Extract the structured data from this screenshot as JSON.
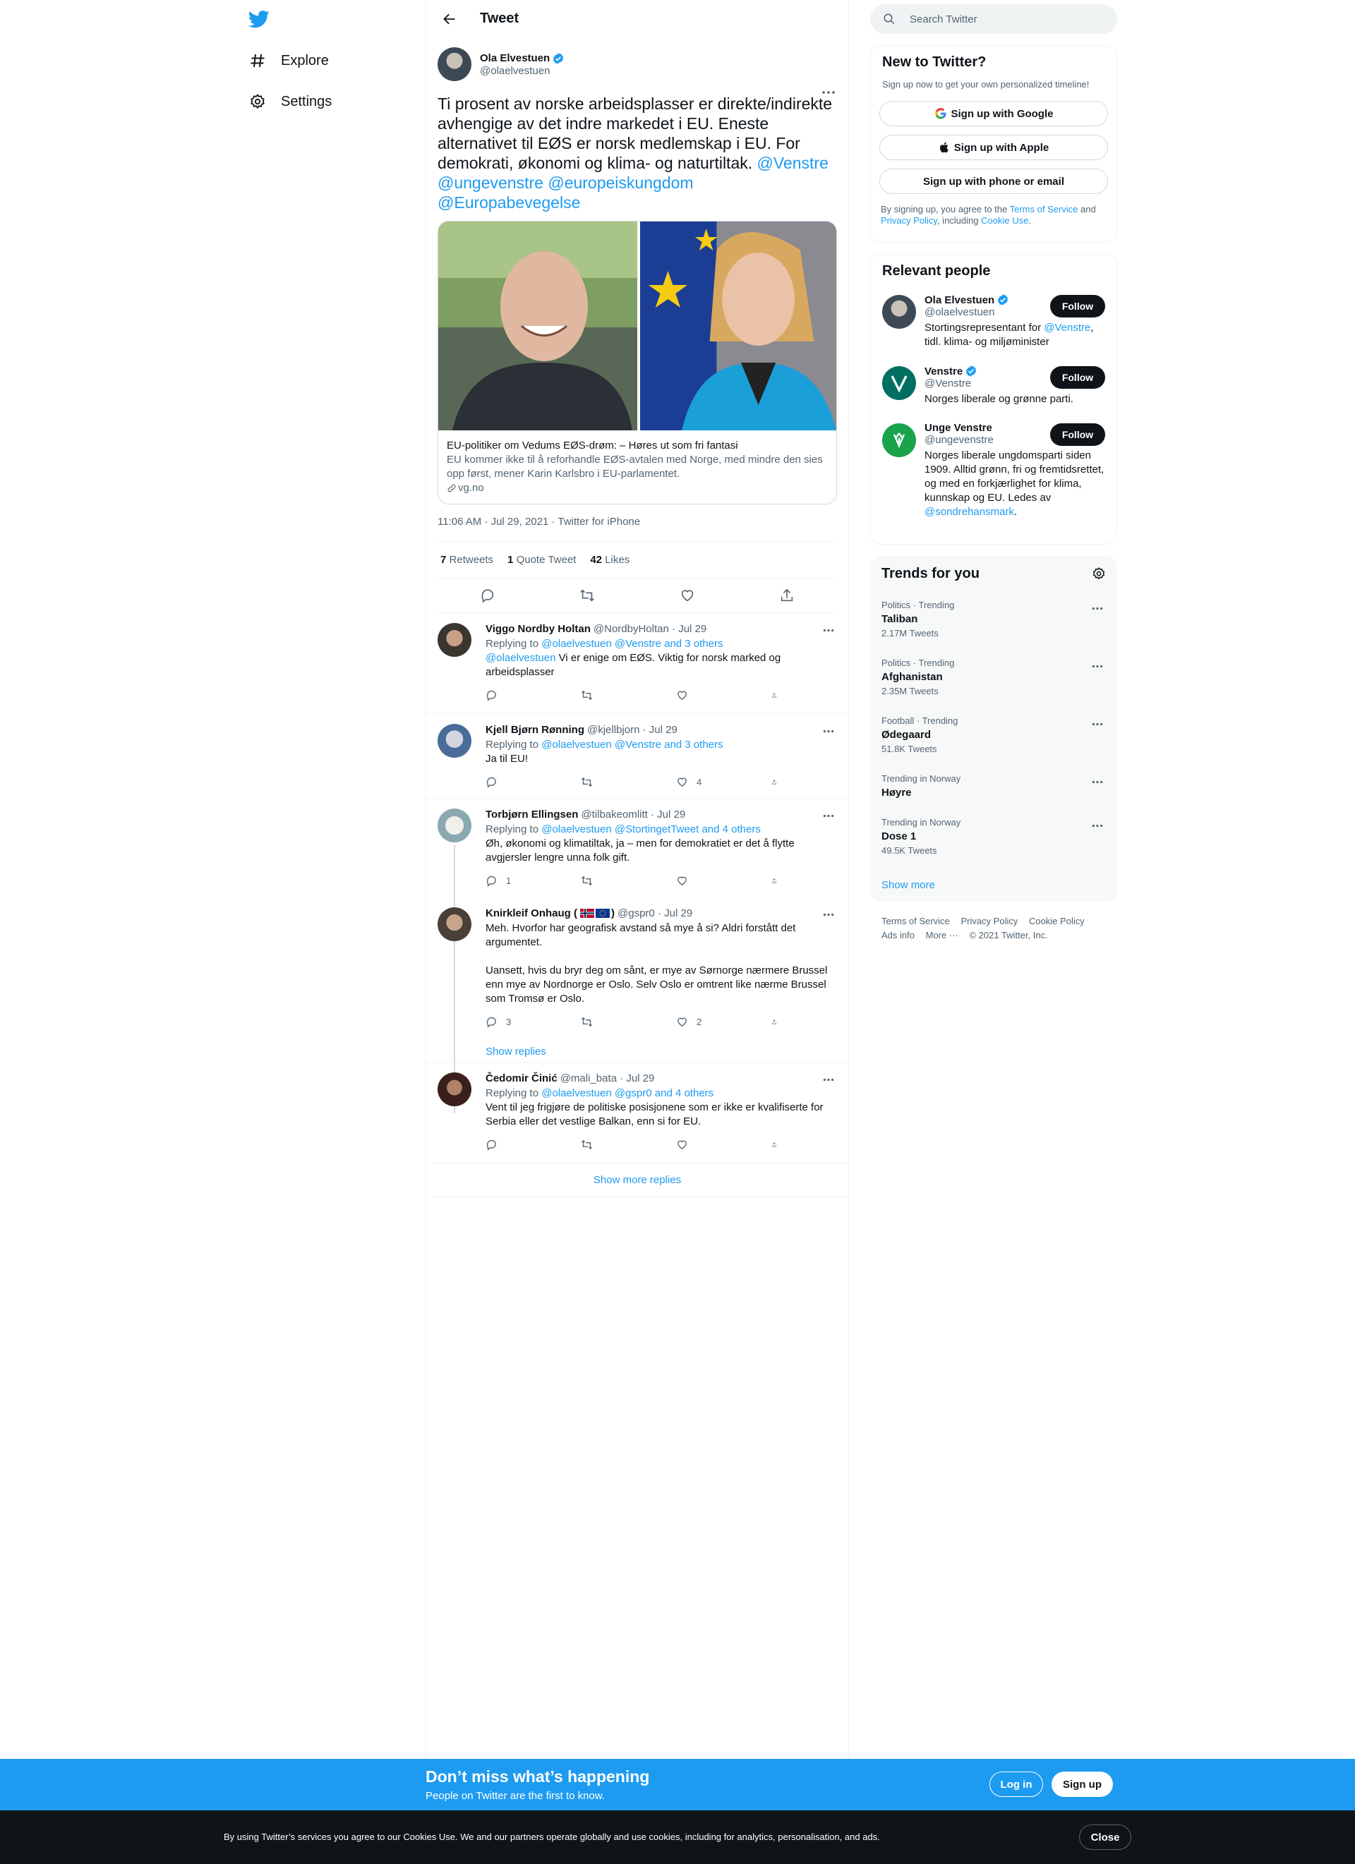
{
  "colors": {
    "accent": "#1d9bf0",
    "text": "#0f1419",
    "muted": "#536471",
    "border": "#eff3f4"
  },
  "nav": {
    "logo": "twitter-bird-icon",
    "items": [
      {
        "label": "Explore",
        "icon": "hashtag-icon"
      },
      {
        "label": "Settings",
        "icon": "gear-icon"
      }
    ]
  },
  "header": {
    "title": "Tweet",
    "back_icon": "arrow-left-icon"
  },
  "tweet": {
    "name": "Ola Elvestuen",
    "handle": "@olaelvestuen",
    "text": "Ti prosent av norske arbeidsplasser er direkte/indirekte avhengige av det indre markedet i EU. Eneste alternativet til EØS er norsk medlemskap i EU. For demokrati, økonomi og klima- og naturtiltak.",
    "mentions": [
      "@Venstre",
      "@ungevenstre",
      "@europeiskungdom",
      "@Europabevegelse"
    ],
    "card": {
      "title": "EU-politiker om Vedums EØS-drøm: – Høres ut som fri fantasi",
      "description": "EU kommer ikke til å reforhandle EØS-avtalen med Norge, med mindre den sies opp først, mener Karin Karlsbro i EU-parlamentet.",
      "domain": "vg.no"
    },
    "meta": "11:06 AM · Jul 29, 2021 · Twitter for iPhone",
    "stats": [
      {
        "count": "7",
        "label": "Retweets"
      },
      {
        "count": "1",
        "label": "Quote Tweet"
      },
      {
        "count": "42",
        "label": "Likes"
      }
    ]
  },
  "replies": [
    {
      "name": "Viggo Nordby Holtan",
      "handle": "@NordbyHoltan",
      "date": "Jul 29",
      "replying_prefix": "Replying to ",
      "replying_to": "@olaelvestuen @Venstre and 3 others",
      "mention": "@olaelvestuen",
      "text": " Vi er enige om EØS. Viktig for norsk marked og arbeidsplasser",
      "counts": {
        "reply": "",
        "retweet": "",
        "like": ""
      }
    },
    {
      "name": "Kjell Bjørn Rønning",
      "handle": "@kjellbjorn",
      "date": "Jul 29",
      "replying_prefix": "Replying to ",
      "replying_to": "@olaelvestuen @Venstre and 3 others",
      "text": "Ja til EU!",
      "counts": {
        "reply": "",
        "retweet": "",
        "like": "4"
      }
    },
    {
      "name": "Torbjørn Ellingsen",
      "handle": "@tilbakeomlitt",
      "date": "Jul 29",
      "replying_prefix": "Replying to ",
      "replying_to": "@olaelvestuen @StortingetTweet and 4 others",
      "text": "Øh, økonomi og klimatiltak, ja – men for demokratiet er det å flytte avgjersler lengre unna folk gift.",
      "counts": {
        "reply": "1",
        "retweet": "",
        "like": ""
      }
    },
    {
      "name": "Knirkleif Onhaug (",
      "name_end": ")",
      "flags": [
        "norway-flag-icon",
        "eu-flag-icon"
      ],
      "handle": "@gspr0",
      "date": "Jul 29",
      "text": "Meh. Hvorfor har geografisk avstand så mye å si? Aldri forstått det argumentet.",
      "text2": "Uansett, hvis du bryr deg om sånt, er mye av Sørnorge nærmere Brussel enn mye av Nordnorge er Oslo. Selv Oslo er omtrent like nærme Brussel som Tromsø er Oslo.",
      "counts": {
        "reply": "3",
        "retweet": "",
        "like": "2"
      },
      "show_replies": "Show replies"
    },
    {
      "name": "Čedomir Činić",
      "handle": "@mali_bata",
      "date": "Jul 29",
      "replying_prefix": "Replying to ",
      "replying_to": "@olaelvestuen @gspr0 and 4 others",
      "text": "Vent til jeg frigjøre de politiske posisjonene som er ikke er kvalifiserte for Serbia eller det vestlige Balkan, enn si for EU.",
      "counts": {
        "reply": "",
        "retweet": "",
        "like": ""
      }
    }
  ],
  "show_more_replies": "Show more replies",
  "search": {
    "placeholder": "Search Twitter"
  },
  "new_to_twitter": {
    "title": "New to Twitter?",
    "subtitle": "Sign up now to get your own personalized timeline!",
    "buttons": [
      "Sign up with Google",
      "Sign up with Apple",
      "Sign up with phone or email"
    ],
    "legal_1": "By signing up, you agree to the ",
    "tos": "Terms of Service",
    "legal_2": " and ",
    "privacy": "Privacy Policy",
    "legal_3": ", including ",
    "cookie": "Cookie Use",
    "legal_4": "."
  },
  "relevant_people": {
    "title": "Relevant people",
    "follow_label": "Follow",
    "people": [
      {
        "name": "Ola Elvestuen",
        "handle": "@olaelvestuen",
        "bio_1": "Stortingsrepresentant for ",
        "bio_link": "@Venstre",
        "bio_2": ", tidl. klima- og miljøminister"
      },
      {
        "name": "Venstre",
        "handle": "@Venstre",
        "bio_1": "Norges liberale og grønne parti.",
        "bio_link": "",
        "bio_2": ""
      },
      {
        "name": "Unge Venstre",
        "handle": "@ungevenstre",
        "bio_1": "Norges liberale ungdomsparti siden 1909. Alltid grønn, fri og fremtidsrettet, og med en forkjærlighet for klima, kunnskap og EU. Ledes av ",
        "bio_link": "@sondrehansmark",
        "bio_2": "."
      }
    ]
  },
  "trends": {
    "title": "Trends for you",
    "items": [
      {
        "category": "Politics · Trending",
        "name": "Taliban",
        "count": "2.17M Tweets"
      },
      {
        "category": "Politics · Trending",
        "name": "Afghanistan",
        "count": "2.35M Tweets"
      },
      {
        "category": "Football · Trending",
        "name": "Ødegaard",
        "count": "51.8K Tweets"
      },
      {
        "category": "Trending in Norway",
        "name": "Høyre",
        "count": ""
      },
      {
        "category": "Trending in Norway",
        "name": "Dose 1",
        "count": "49.5K Tweets"
      }
    ],
    "show_more": "Show more"
  },
  "footer": {
    "links": [
      "Terms of Service",
      "Privacy Policy",
      "Cookie Policy",
      "Ads info",
      "More ···",
      "© 2021 Twitter, Inc."
    ]
  },
  "banner": {
    "title": "Don’t miss what’s happening",
    "subtitle": "People on Twitter are the first to know.",
    "login": "Log in",
    "signup": "Sign up"
  },
  "cookie_bar": {
    "text": "By using Twitter’s services you agree to our Cookies Use. We and our partners operate globally and use cookies, including for analytics, personalisation, and ads.",
    "close": "Close"
  }
}
